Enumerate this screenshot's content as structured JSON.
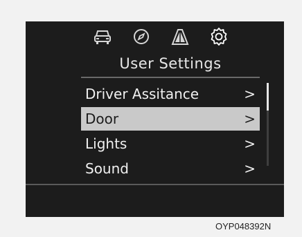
{
  "header": {
    "icons": [
      "car-icon",
      "compass-icon",
      "road-icon",
      "gear-icon"
    ]
  },
  "title": "User Settings",
  "menu": {
    "items": [
      {
        "label": "Driver Assitance",
        "chevron": ">"
      },
      {
        "label": "Door",
        "chevron": ">",
        "selected": true
      },
      {
        "label": "Lights",
        "chevron": ">"
      },
      {
        "label": "Sound",
        "chevron": ">"
      }
    ]
  },
  "scrollbar": {
    "position_fraction": 0.0,
    "visible_fraction": 0.33
  },
  "caption": "OYP048392N",
  "colors": {
    "screen_bg": "#1c1c1c",
    "selected_bg": "#c9c9c9",
    "text": "#f0f0f0",
    "border": "#f2f2f2"
  }
}
